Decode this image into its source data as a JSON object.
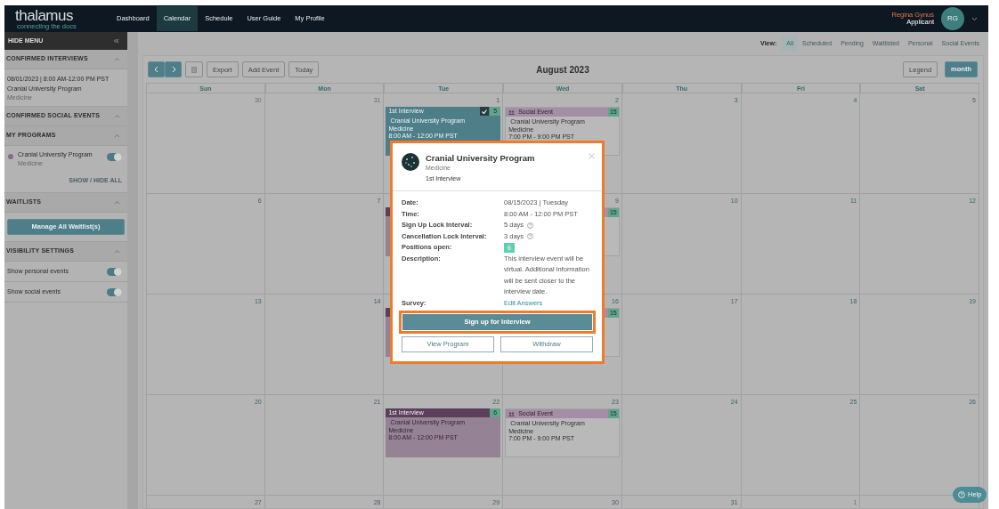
{
  "navbar": {
    "logo": "thalamus",
    "tagline": "connecting the docs",
    "links": [
      {
        "label": "Dashboard",
        "selected": false
      },
      {
        "label": "Calendar",
        "selected": true
      },
      {
        "label": "Schedule",
        "selected": false
      },
      {
        "label": "User Guide",
        "selected": false
      },
      {
        "label": "My Profile",
        "selected": false
      }
    ],
    "user": {
      "name": "Regina Gynus",
      "role": "Applicant",
      "initials": "RG"
    }
  },
  "sidebar": {
    "hide_label": "HIDE MENU",
    "sections": [
      {
        "kind": "interviews",
        "title": "CONFIRMED INTERVIEWS",
        "expanded": true,
        "items": [
          {
            "when": "08/01/2023 | 8:00 AM-12:00 PM PST",
            "program": "Cranial University Program",
            "specialty": "Medicine"
          }
        ]
      },
      {
        "kind": "interviews",
        "title": "CONFIRMED SOCIAL EVENTS",
        "expanded": true
      },
      {
        "kind": "programs",
        "title": "MY PROGRAMS",
        "expanded": true,
        "programs": [
          {
            "name": "Cranial University Program",
            "specialty": "Medicine",
            "color": "#8a6a88",
            "on": true
          }
        ],
        "footer": "SHOW / HIDE ALL"
      },
      {
        "kind": "button",
        "title": "WAITLISTS",
        "expanded": true,
        "button": "Manage All Waitlist(s)"
      },
      {
        "kind": "toggles",
        "title": "VISIBILITY SETTINGS",
        "expanded": true,
        "toggles": [
          {
            "label": "Show personal events",
            "on": true
          },
          {
            "label": "Show social events",
            "on": true
          }
        ]
      }
    ]
  },
  "calendar": {
    "view_label": "View:",
    "filters": [
      {
        "label": "All",
        "selected": true
      },
      {
        "label": "Scheduled",
        "selected": false
      },
      {
        "label": "Pending",
        "selected": false
      },
      {
        "label": "Waitlisted",
        "selected": false
      },
      {
        "label": "Personal",
        "selected": false
      },
      {
        "label": "Social Events",
        "selected": false
      }
    ],
    "export": "Export",
    "add_event": "Add Event",
    "today": "Today",
    "title": "August 2023",
    "legend": "Legend",
    "view_buttons": [
      {
        "label": "month",
        "selected": true
      }
    ],
    "weekdays": [
      "Sun",
      "Mon",
      "Tue",
      "Wed",
      "Thu",
      "Fri",
      "Sat"
    ],
    "weeks": [
      [
        {
          "date": "30",
          "other_month": true
        },
        {
          "date": "31",
          "other_month": true
        },
        {
          "date": "1",
          "other_month": false,
          "events": [
            {
              "kind": "interview",
              "color": "#4e7e88",
              "header": "1st Interview",
              "checked": true,
              "badge": "5",
              "program": "Cranial University Program",
              "specialty": "Medicine",
              "time": "8:00 AM - 12:00 PM PST"
            }
          ]
        },
        {
          "date": "2",
          "other_month": false,
          "events": [
            {
              "kind": "social",
              "color": "#a58ea5",
              "header": "Social Event",
              "badge": "15",
              "program": "Cranial University Program",
              "specialty": "Medicine",
              "time": "7:00 PM - 9:00 PM PST"
            }
          ]
        },
        {
          "date": "3",
          "other_month": false
        },
        {
          "date": "4",
          "other_month": false
        },
        {
          "date": "5",
          "other_month": false
        }
      ],
      [
        {
          "date": "6",
          "other_month": false
        },
        {
          "date": "7",
          "other_month": false
        },
        {
          "events": [
            {
              "kind": "interview",
              "color": "#5c3f5a"
            }
          ]
        },
        {
          "date": "9",
          "other_month": false,
          "events": [
            {
              "kind": "social",
              "color": "#a58ea5",
              "badge": "15"
            }
          ]
        },
        {
          "date": "10",
          "other_month": false
        },
        {
          "date": "11",
          "other_month": false
        },
        {
          "date": "12",
          "other_month": false
        }
      ],
      [
        {
          "date": "13",
          "other_month": false
        },
        {
          "date": "14",
          "other_month": false
        },
        {
          "events": [
            {
              "kind": "interview",
              "color": "#5c3f5a"
            }
          ]
        },
        {
          "date": "16",
          "other_month": false,
          "events": [
            {
              "kind": "social",
              "color": "#a58ea5",
              "badge": "15"
            }
          ]
        },
        {
          "date": "17",
          "other_month": false
        },
        {
          "date": "18",
          "other_month": false
        },
        {
          "date": "19",
          "other_month": false
        }
      ],
      [
        {
          "date": "20",
          "other_month": false
        },
        {
          "date": "21",
          "other_month": false
        },
        {
          "date": "22",
          "other_month": false,
          "events": [
            {
              "kind": "interview",
              "color": "#5c3f5a",
              "header": "1st Interview",
              "checked": false,
              "badge": "6",
              "program": "Cranial University Program",
              "specialty": "Medicine",
              "time": "8:00 AM - 12:00 PM PST"
            }
          ]
        },
        {
          "date": "23",
          "other_month": false,
          "events": [
            {
              "kind": "social",
              "color": "#a58ea5",
              "header": "Social Event",
              "badge": "15",
              "program": "Cranial University Program",
              "specialty": "Medicine",
              "time": "7:00 PM - 9:00 PM PST"
            }
          ]
        },
        {
          "date": "24",
          "other_month": false
        },
        {
          "date": "25",
          "other_month": false
        },
        {
          "date": "26",
          "other_month": false
        }
      ],
      [
        {
          "date": "27",
          "other_month": false
        },
        {
          "date": "28",
          "other_month": false
        },
        {
          "date": "29",
          "other_month": false
        },
        {
          "date": "30",
          "other_month": false
        },
        {
          "date": "31",
          "other_month": false
        },
        {
          "date": "1",
          "other_month": true
        }
      ]
    ]
  },
  "modal": {
    "program": "Cranial University Program",
    "specialty": "Medicine",
    "event": "1st Interview",
    "rows": [
      {
        "kind": "text",
        "label": "Date:",
        "value": "08/15/2023 | Tuesday"
      },
      {
        "kind": "text",
        "label": "Time:",
        "value": "8:00 AM - 12:00 PM PST"
      },
      {
        "kind": "help",
        "label": "Sign Up Lock Interval:",
        "value": "5 days"
      },
      {
        "kind": "help",
        "label": "Cancellation Lock Interval:",
        "value": "3 days"
      },
      {
        "kind": "badge",
        "label": "Positions open:",
        "value": "6"
      },
      {
        "kind": "text",
        "label": "Description:",
        "value": "This interview event will be virtual.  Additional information will be sent closer to the interview date."
      },
      {
        "kind": "link",
        "label": "Survey:",
        "value": "Edit Answers"
      }
    ],
    "primary": "Sign up for Interview",
    "secondary": [
      "View Program",
      "Withdraw"
    ]
  },
  "help": "Help"
}
